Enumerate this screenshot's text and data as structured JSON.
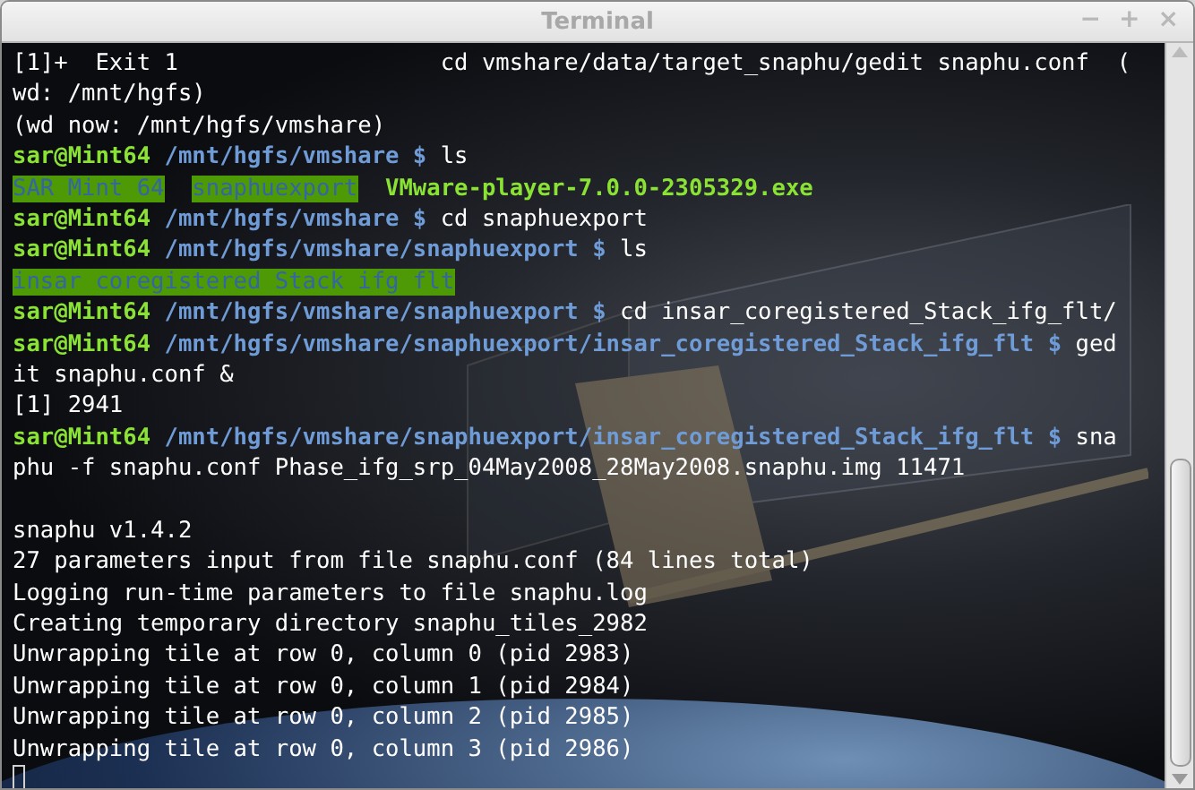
{
  "window": {
    "title": "Terminal",
    "controls": [
      "−",
      "+",
      "×"
    ]
  },
  "lines": [
    {
      "kind": "text",
      "segments": [
        {
          "kind": "plain",
          "text": "[1]+  Exit 1                   cd vmshare/data/target_snaphu/gedit snaphu.conf  ("
        }
      ]
    },
    {
      "kind": "text",
      "segments": [
        {
          "kind": "plain",
          "text": "wd: /mnt/hgfs)"
        }
      ]
    },
    {
      "kind": "text",
      "segments": [
        {
          "kind": "plain",
          "text": "(wd now: /mnt/hgfs/vmshare)"
        }
      ]
    },
    {
      "kind": "text",
      "segments": [
        {
          "kind": "user",
          "text": "sar@Mint64"
        },
        {
          "kind": "path",
          "text": "/mnt/hgfs/vmshare $"
        },
        {
          "kind": "plain",
          "text": " ls"
        }
      ]
    },
    {
      "kind": "text",
      "segments": [
        {
          "kind": "dir",
          "text": "SAR Mint 64"
        },
        {
          "kind": "dir",
          "text": "snaphuexport"
        },
        {
          "kind": "exe",
          "text": "VMware-player-7.0.0-2305329.exe"
        }
      ]
    },
    {
      "kind": "text",
      "segments": [
        {
          "kind": "user",
          "text": "sar@Mint64"
        },
        {
          "kind": "path",
          "text": "/mnt/hgfs/vmshare $"
        },
        {
          "kind": "plain",
          "text": " cd snaphuexport"
        }
      ]
    },
    {
      "kind": "text",
      "segments": [
        {
          "kind": "user",
          "text": "sar@Mint64"
        },
        {
          "kind": "path",
          "text": "/mnt/hgfs/vmshare/snaphuexport $"
        },
        {
          "kind": "plain",
          "text": " ls"
        }
      ]
    },
    {
      "kind": "text",
      "segments": [
        {
          "kind": "dir",
          "text": "insar coregistered Stack ifg flt"
        }
      ]
    },
    {
      "kind": "text",
      "segments": [
        {
          "kind": "user",
          "text": "sar@Mint64"
        },
        {
          "kind": "path",
          "text": "/mnt/hgfs/vmshare/snaphuexport $"
        },
        {
          "kind": "plain",
          "text": " cd insar_coregistered_Stack_ifg_flt/"
        }
      ]
    },
    {
      "kind": "text",
      "segments": [
        {
          "kind": "user",
          "text": "sar@Mint64"
        },
        {
          "kind": "path",
          "text": "/mnt/hgfs/vmshare/snaphuexport/insar_coregistered_Stack_ifg_flt $"
        },
        {
          "kind": "plain",
          "text": " ged"
        }
      ]
    },
    {
      "kind": "text",
      "segments": [
        {
          "kind": "plain",
          "text": "it snaphu.conf &"
        }
      ]
    },
    {
      "kind": "text",
      "segments": [
        {
          "kind": "plain",
          "text": "[1] 2941"
        }
      ]
    },
    {
      "kind": "text",
      "segments": [
        {
          "kind": "user",
          "text": "sar@Mint64"
        },
        {
          "kind": "path",
          "text": "/mnt/hgfs/vmshare/snaphuexport/insar_coregistered_Stack_ifg_flt $"
        },
        {
          "kind": "plain",
          "text": " sna"
        }
      ]
    },
    {
      "kind": "text",
      "segments": [
        {
          "kind": "plain",
          "text": "phu -f snaphu.conf Phase_ifg_srp_04May2008_28May2008.snaphu.img 11471"
        }
      ]
    },
    {
      "kind": "blank"
    },
    {
      "kind": "text",
      "segments": [
        {
          "kind": "plain",
          "text": "snaphu v1.4.2"
        }
      ]
    },
    {
      "kind": "text",
      "segments": [
        {
          "kind": "plain",
          "text": "27 parameters input from file snaphu.conf (84 lines total)"
        }
      ]
    },
    {
      "kind": "text",
      "segments": [
        {
          "kind": "plain",
          "text": "Logging run-time parameters to file snaphu.log"
        }
      ]
    },
    {
      "kind": "text",
      "segments": [
        {
          "kind": "plain",
          "text": "Creating temporary directory snaphu_tiles_2982"
        }
      ]
    },
    {
      "kind": "text",
      "segments": [
        {
          "kind": "plain",
          "text": "Unwrapping tile at row 0, column 0 (pid 2983)"
        }
      ]
    },
    {
      "kind": "text",
      "segments": [
        {
          "kind": "plain",
          "text": "Unwrapping tile at row 0, column 1 (pid 2984)"
        }
      ]
    },
    {
      "kind": "text",
      "segments": [
        {
          "kind": "plain",
          "text": "Unwrapping tile at row 0, column 2 (pid 2985)"
        }
      ]
    },
    {
      "kind": "text",
      "segments": [
        {
          "kind": "plain",
          "text": "Unwrapping tile at row 0, column 3 (pid 2986)"
        }
      ]
    },
    {
      "kind": "cursor"
    }
  ]
}
